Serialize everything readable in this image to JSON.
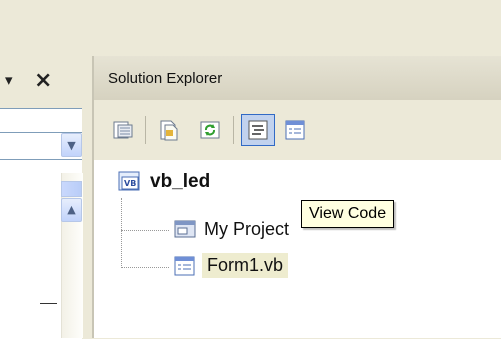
{
  "left_pane": {
    "dropdown_glyph": "▾",
    "close_glyph": "×",
    "combo_arrow": "▼",
    "scroll_up": "▲"
  },
  "solution_explorer": {
    "title": "Solution Explorer",
    "toolbar": [
      {
        "name": "properties-button",
        "icon": "properties-icon",
        "active": false
      },
      {
        "name": "show-all-files-button",
        "icon": "show-all-files-icon",
        "active": false
      },
      {
        "name": "refresh-button",
        "icon": "refresh-icon",
        "active": false
      },
      {
        "name": "view-code-button",
        "icon": "view-code-icon",
        "active": true
      },
      {
        "name": "view-designer-button",
        "icon": "view-designer-icon",
        "active": false
      }
    ],
    "tree": {
      "project": "vb_led",
      "my_project": "My Project",
      "form": "Form1.vb"
    },
    "tooltip": "View Code"
  },
  "colors": {
    "chrome": "#ece9d8",
    "selection_border": "#316ac5",
    "selection_fill": "#c1d2ee",
    "tooltip_bg": "#ffffe1"
  }
}
